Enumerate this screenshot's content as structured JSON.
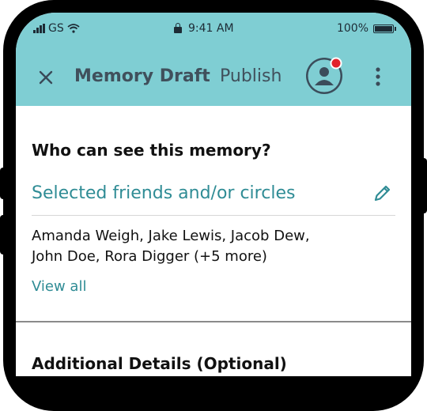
{
  "status_bar": {
    "carrier": "GS",
    "time": "9:41 AM",
    "battery": "100%",
    "battery_level": 1.0
  },
  "app_bar": {
    "title": "Memory Draft",
    "publish_label": "Publish",
    "has_notification": true,
    "colors": {
      "background": "#7fced3",
      "notification_dot": "#e2222b"
    }
  },
  "visibility": {
    "heading": "Who can see this memory?",
    "selected_label": "Selected friends and/or circles",
    "names_line1": "Amanda Weigh, Jake Lewis, Jacob Dew,",
    "names_line2": "John Doe, Rora Digger (+5 more)",
    "view_all_label": "View all"
  },
  "additional_details": {
    "heading": "Additional Details (Optional)"
  },
  "icons": [
    "close-icon",
    "avatar-icon",
    "more-vertical-icon",
    "pencil-icon",
    "signal-icon",
    "wifi-icon",
    "lock-icon",
    "battery-icon"
  ]
}
